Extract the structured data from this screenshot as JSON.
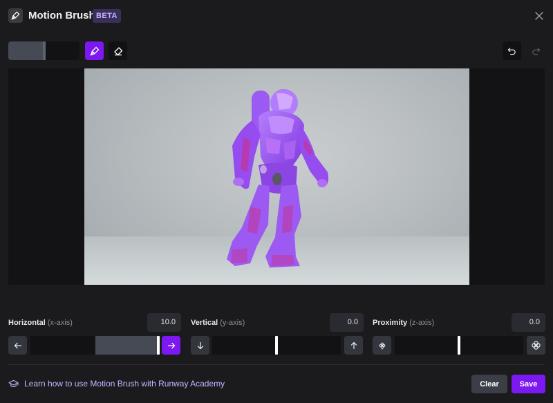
{
  "header": {
    "title": "Motion Brush",
    "badge": "BETA",
    "icon": "brush-icon",
    "close_icon": "close-icon"
  },
  "toolbar": {
    "brush_size": 0.5,
    "tools": [
      {
        "name": "brush-icon",
        "active": true
      },
      {
        "name": "eraser-icon",
        "active": false
      }
    ],
    "history": [
      {
        "name": "undo-icon",
        "enabled": true
      },
      {
        "name": "redo-icon",
        "enabled": false
      }
    ]
  },
  "controls": {
    "horizontal": {
      "label": "Horizontal",
      "axis": "(x-axis)",
      "value": "10.0",
      "min_icon": "arrow-left-icon",
      "max_icon": "arrow-right-icon",
      "level": 1.0
    },
    "vertical": {
      "label": "Vertical",
      "axis": "(y-axis)",
      "value": "0.0",
      "min_icon": "arrow-down-icon",
      "max_icon": "arrow-up-icon",
      "level": 0.5
    },
    "proximity": {
      "label": "Proximity",
      "axis": "(z-axis)",
      "value": "0.0",
      "min_icon": "flower-small-icon",
      "max_icon": "flower-large-icon",
      "level": 0.5
    }
  },
  "footer": {
    "academy_text": "Learn how to use Motion Brush with Runway Academy",
    "academy_icon": "graduation-cap-icon",
    "clear_label": "Clear",
    "save_label": "Save"
  },
  "colors": {
    "accent": "#7b19f0",
    "mask": "#9b4dff",
    "background": "#1b1b1e"
  }
}
